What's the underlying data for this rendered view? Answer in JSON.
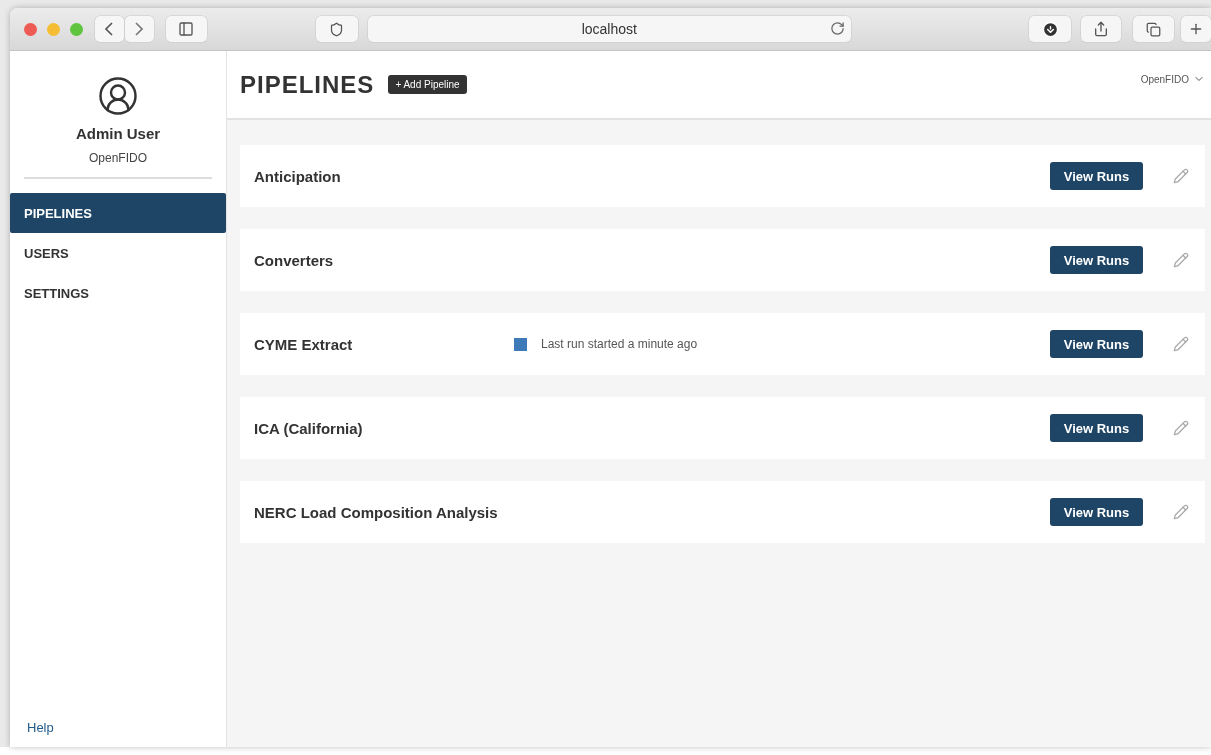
{
  "browser": {
    "url": "localhost"
  },
  "sidebar": {
    "user": {
      "name": "Admin User",
      "org": "OpenFIDO"
    },
    "items": [
      {
        "label": "PIPELINES",
        "selected": true
      },
      {
        "label": "USERS",
        "selected": false
      },
      {
        "label": "SETTINGS",
        "selected": false
      }
    ],
    "help": "Help"
  },
  "header": {
    "title": "PIPELINES",
    "add_button": "+ Add Pipeline",
    "org_menu": "OpenFIDO"
  },
  "pipelines": [
    {
      "name": "Anticipation",
      "button": "View Runs"
    },
    {
      "name": "Converters",
      "button": "View Runs"
    },
    {
      "name": "CYME Extract",
      "status": "Last run started a minute ago",
      "color": "#3f7ab8",
      "button": "View Runs"
    },
    {
      "name": "ICA (California)",
      "button": "View Runs"
    },
    {
      "name": "NERC Load Composition Analysis",
      "button": "View Runs"
    }
  ]
}
